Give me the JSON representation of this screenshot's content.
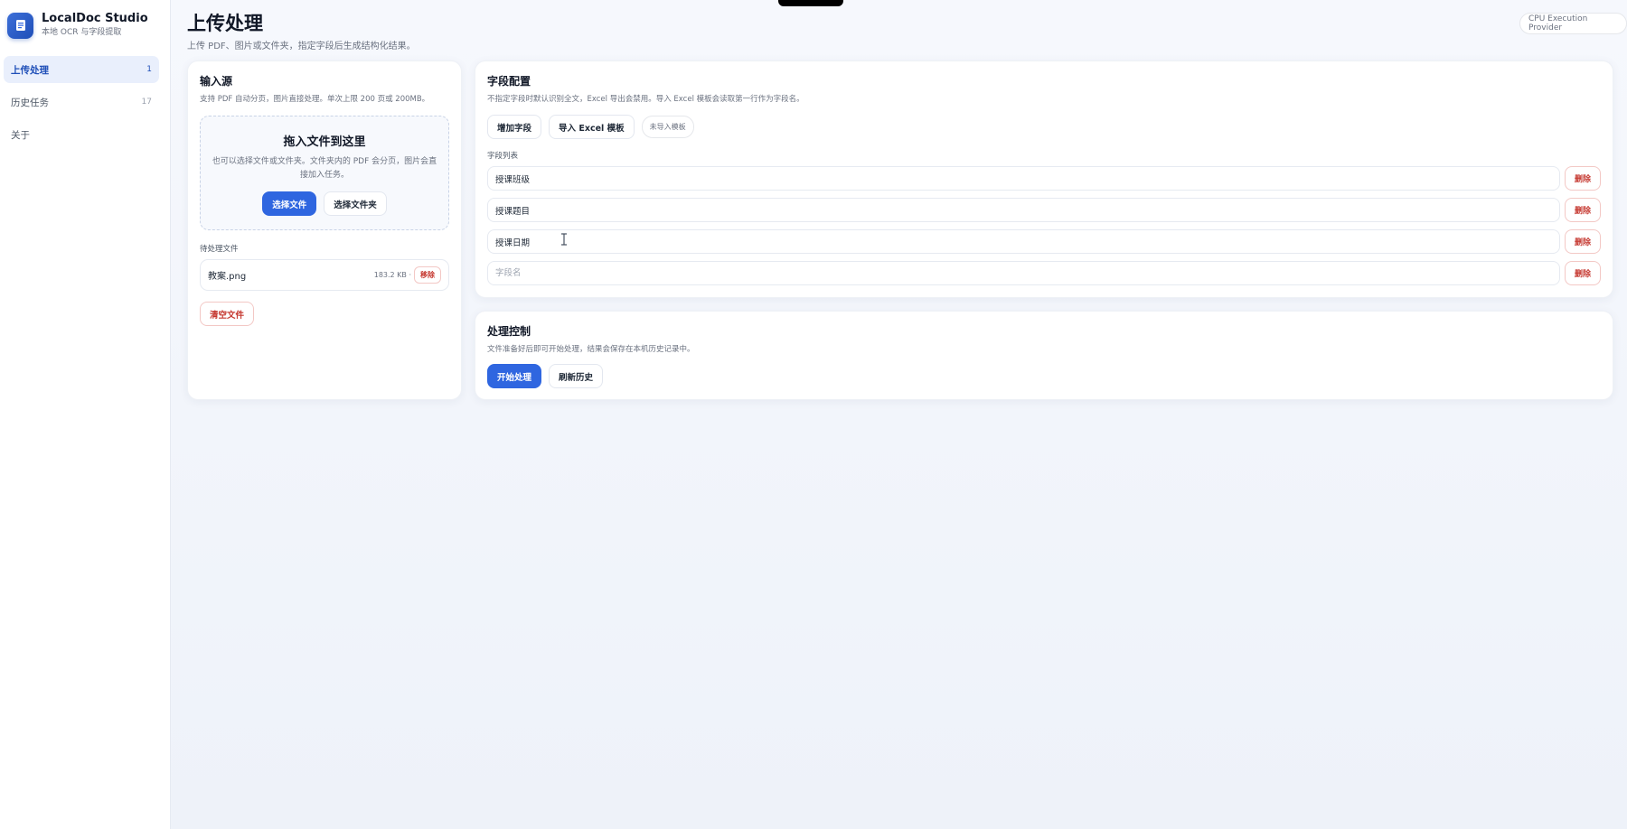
{
  "app": {
    "title": "LocalDoc Studio",
    "subtitle": "本地 OCR 与字段提取",
    "brand_color": "#2f66e0"
  },
  "sidebar": {
    "items": [
      {
        "label": "上传处理",
        "count": "1",
        "active": true
      },
      {
        "label": "历史任务",
        "count": "17",
        "active": false
      },
      {
        "label": "关于",
        "count": "",
        "active": false
      }
    ]
  },
  "header": {
    "title": "上传处理",
    "subtitle": "上传 PDF、图片或文件夹，指定字段后生成结构化结果。",
    "provider": "CPU Execution Provider"
  },
  "input_card": {
    "title": "输入源",
    "subtitle": "支持 PDF 自动分页，图片直接处理。单次上限 200 页或 200MB。",
    "dropzone": {
      "title": "拖入文件到这里",
      "description": "也可以选择文件或文件夹。文件夹内的 PDF 会分页，图片会直接加入任务。",
      "select_file": "选择文件",
      "select_folder": "选择文件夹"
    },
    "pending_label": "待处理文件",
    "files": [
      {
        "name": "教案.png",
        "size": "183.2 KB ·",
        "remove": "移除"
      }
    ],
    "clear": "清空文件"
  },
  "field_card": {
    "title": "字段配置",
    "subtitle": "不指定字段时默认识别全文，Excel 导出会禁用。导入 Excel 模板会读取第一行作为字段名。",
    "add_field": "增加字段",
    "import_excel": "导入 Excel 模板",
    "template_status": "未导入模板",
    "list_label": "字段列表",
    "placeholder": "字段名",
    "delete_label": "删除",
    "fields": [
      "授课班级",
      "授课题目",
      "授课日期",
      ""
    ]
  },
  "control_card": {
    "title": "处理控制",
    "subtitle": "文件准备好后即可开始处理，结果会保存在本机历史记录中。",
    "start": "开始处理",
    "refresh": "刷新历史"
  }
}
